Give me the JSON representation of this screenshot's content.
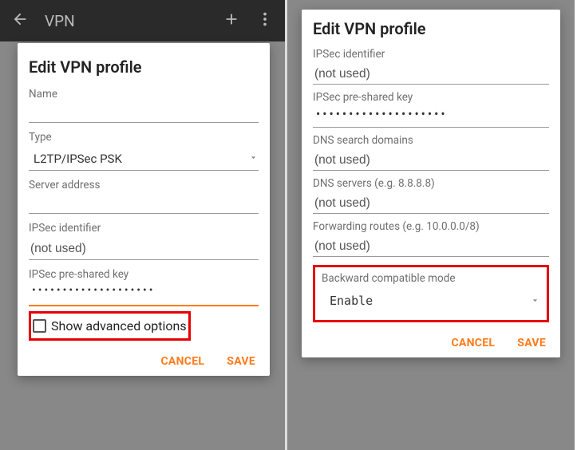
{
  "topbar": {
    "title": "VPN"
  },
  "left": {
    "title": "Edit VPN profile",
    "name_label": "Name",
    "name_value": "",
    "type_label": "Type",
    "type_value": "L2TP/IPSec PSK",
    "server_label": "Server address",
    "server_value": "",
    "ipsec_id_label": "IPSec identifier",
    "ipsec_id_value": "(not used)",
    "psk_label": "IPSec pre-shared key",
    "psk_value": "••••••••••••••••••••",
    "show_adv_label": "Show advanced options",
    "cancel": "CANCEL",
    "save": "SAVE"
  },
  "right": {
    "title": "Edit VPN profile",
    "ipsec_id_label": "IPSec identifier",
    "ipsec_id_value": "(not used)",
    "psk_label": "IPSec pre-shared key",
    "psk_value": "••••••••••••••••••••",
    "dns_search_label": "DNS search domains",
    "dns_search_value": "(not used)",
    "dns_servers_label": "DNS servers (e.g. 8.8.8.8)",
    "dns_servers_value": "(not used)",
    "routes_label": "Forwarding routes (e.g. 10.0.0.0/8)",
    "routes_value": "(not used)",
    "compat_label": "Backward compatible mode",
    "compat_value": "Enable",
    "cancel": "CANCEL",
    "save": "SAVE"
  }
}
